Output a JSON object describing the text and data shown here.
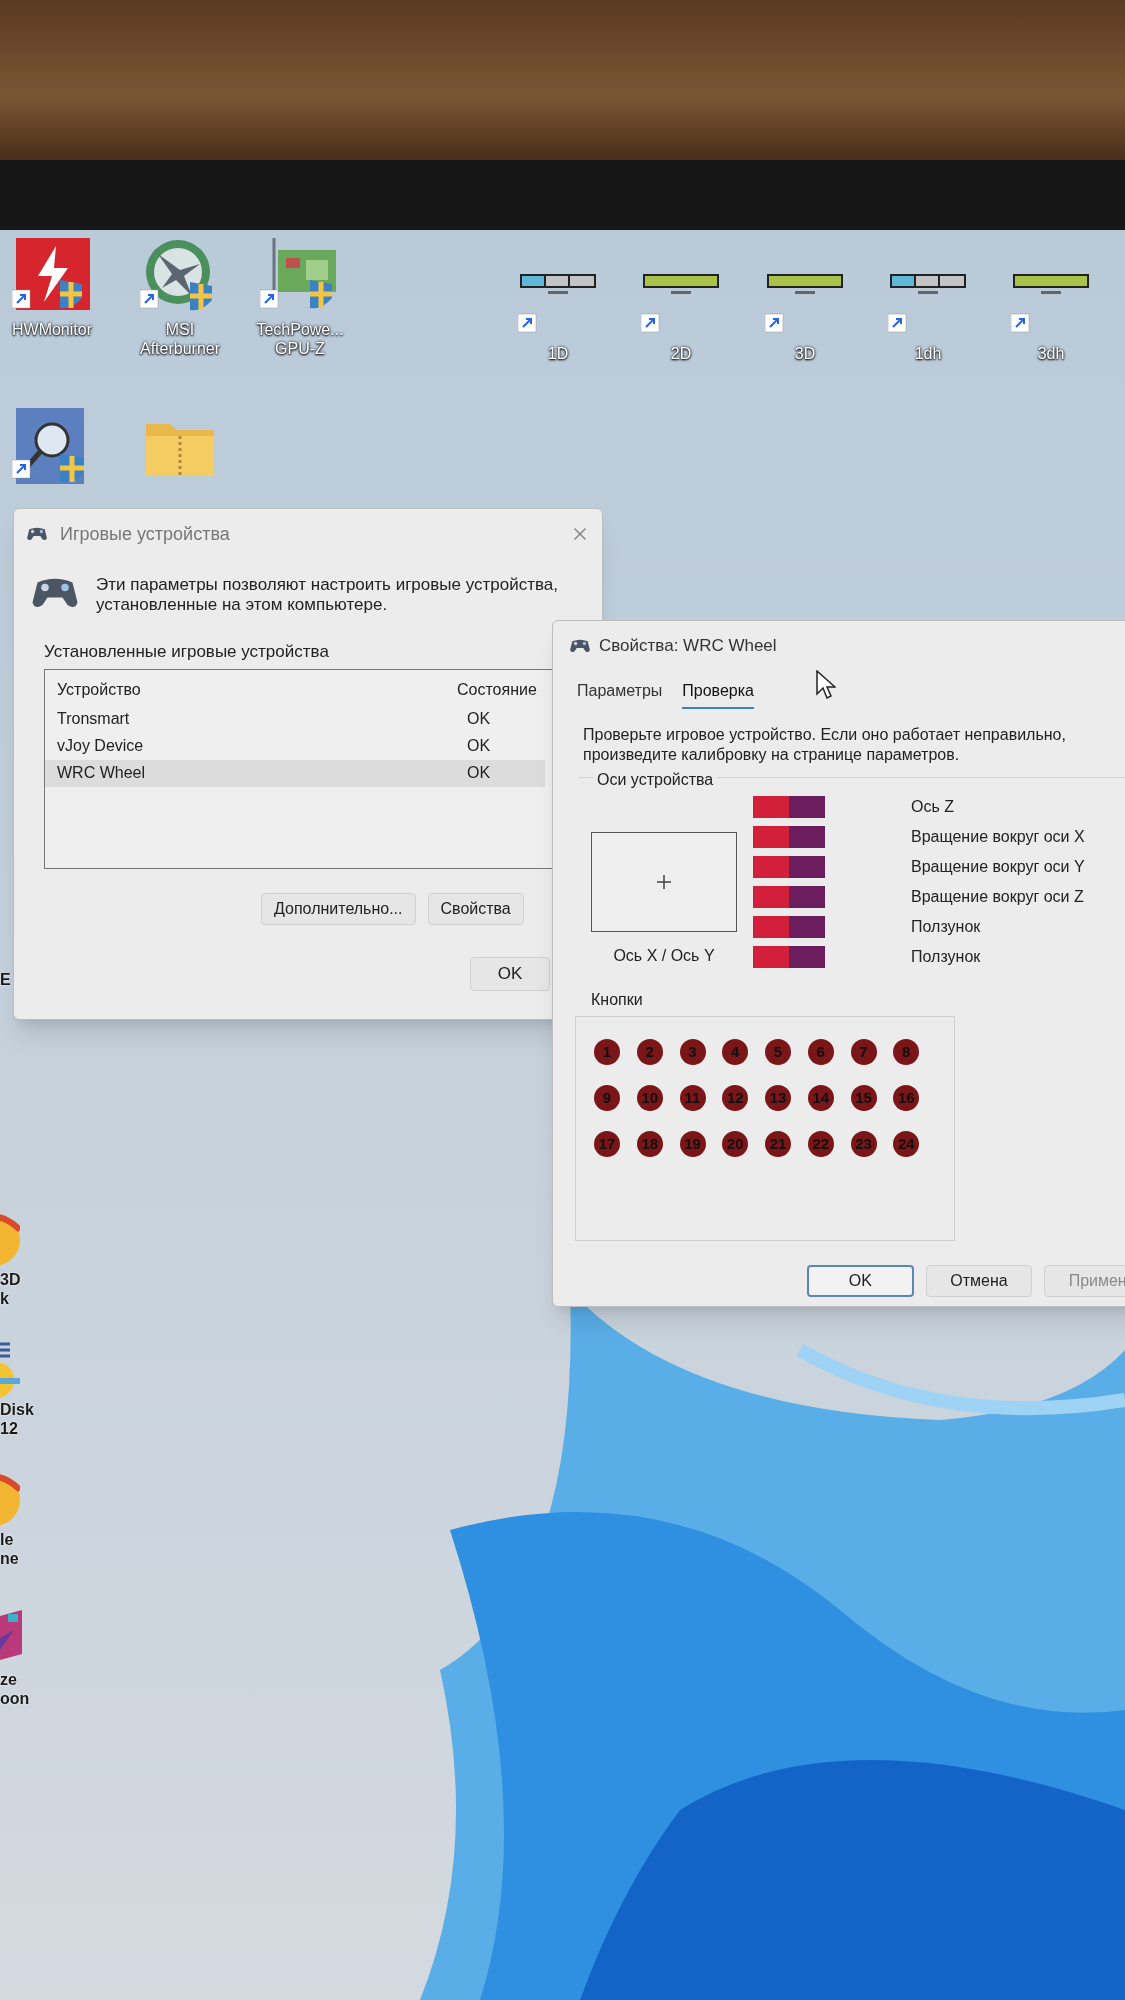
{
  "desktop_icons": [
    {
      "kind": "hwmonitor",
      "lines": [
        "HWMonitor"
      ]
    },
    {
      "kind": "afterburner",
      "lines": [
        "MSI",
        "Afterburner"
      ]
    },
    {
      "kind": "gpuz",
      "lines": [
        "TechPowe...",
        "GPU-Z"
      ]
    },
    {
      "kind": "bar_split",
      "lines": [
        "1D"
      ]
    },
    {
      "kind": "bar_green",
      "lines": [
        "2D"
      ]
    },
    {
      "kind": "bar_green",
      "lines": [
        "3D"
      ]
    },
    {
      "kind": "bar_split",
      "lines": [
        "1dh"
      ]
    },
    {
      "kind": "bar_green",
      "lines": [
        "3dh"
      ]
    },
    {
      "kind": "magnifier"
    },
    {
      "kind": "folder"
    }
  ],
  "edge_fragments": [
    {
      "kind": "text",
      "lines": [
        "E"
      ]
    },
    {
      "kind": "disc",
      "lines": [
        "3D",
        "k"
      ]
    },
    {
      "kind": "stack",
      "lines": [
        "Disk",
        "12"
      ]
    },
    {
      "kind": "disc",
      "lines": [
        "le",
        "ne"
      ]
    },
    {
      "kind": "tiles",
      "lines": [
        "ze",
        "oon"
      ]
    }
  ],
  "games_dialog": {
    "title": "Игровые устройства",
    "description": "Эти параметры позволяют настроить игровые устройства, установленные на этом компьютере.",
    "group_label": "Установленные игровые устройства",
    "columns": [
      "Устройство",
      "Состояние"
    ],
    "rows": [
      {
        "device": "Tronsmart",
        "status": "OK",
        "selected": false
      },
      {
        "device": "vJoy Device",
        "status": "OK",
        "selected": false
      },
      {
        "device": "WRC Wheel",
        "status": "OK",
        "selected": true
      }
    ],
    "buttons": [
      "Дополнительно...",
      "Свойства"
    ],
    "ok": "OK"
  },
  "properties_dialog": {
    "title": "Свойства: WRC Wheel",
    "tabs": [
      {
        "label": "Параметры",
        "selected": false
      },
      {
        "label": "Проверка",
        "selected": true
      }
    ],
    "instructions": "Проверьте игровое устройство. Если оно работает неправильно, произведите калибровку на странице параметров.",
    "axes_group": "Оси устройства",
    "xy_label": "Ось X / Ось Y",
    "axes": [
      {
        "name": "Ось Z",
        "level": 0.5
      },
      {
        "name": "Вращение вокруг оси X",
        "level": 0.5
      },
      {
        "name": "Вращение вокруг оси Y",
        "level": 0.5
      },
      {
        "name": "Вращение вокруг оси Z",
        "level": 0.5
      },
      {
        "name": "Ползунок",
        "level": 0.5
      },
      {
        "name": "Ползунок",
        "level": 0.5
      }
    ],
    "buttons_group": "Кнопки",
    "buttons": [
      "1",
      "2",
      "3",
      "4",
      "5",
      "6",
      "7",
      "8",
      "9",
      "10",
      "11",
      "12",
      "13",
      "14",
      "15",
      "16",
      "17",
      "18",
      "19",
      "20",
      "21",
      "22",
      "23",
      "24"
    ],
    "footer_buttons": [
      {
        "label": "OK",
        "kind": "default",
        "disabled": false
      },
      {
        "label": "Отмена",
        "kind": "normal",
        "disabled": false
      },
      {
        "label": "Примен",
        "kind": "normal",
        "disabled": true
      }
    ]
  }
}
